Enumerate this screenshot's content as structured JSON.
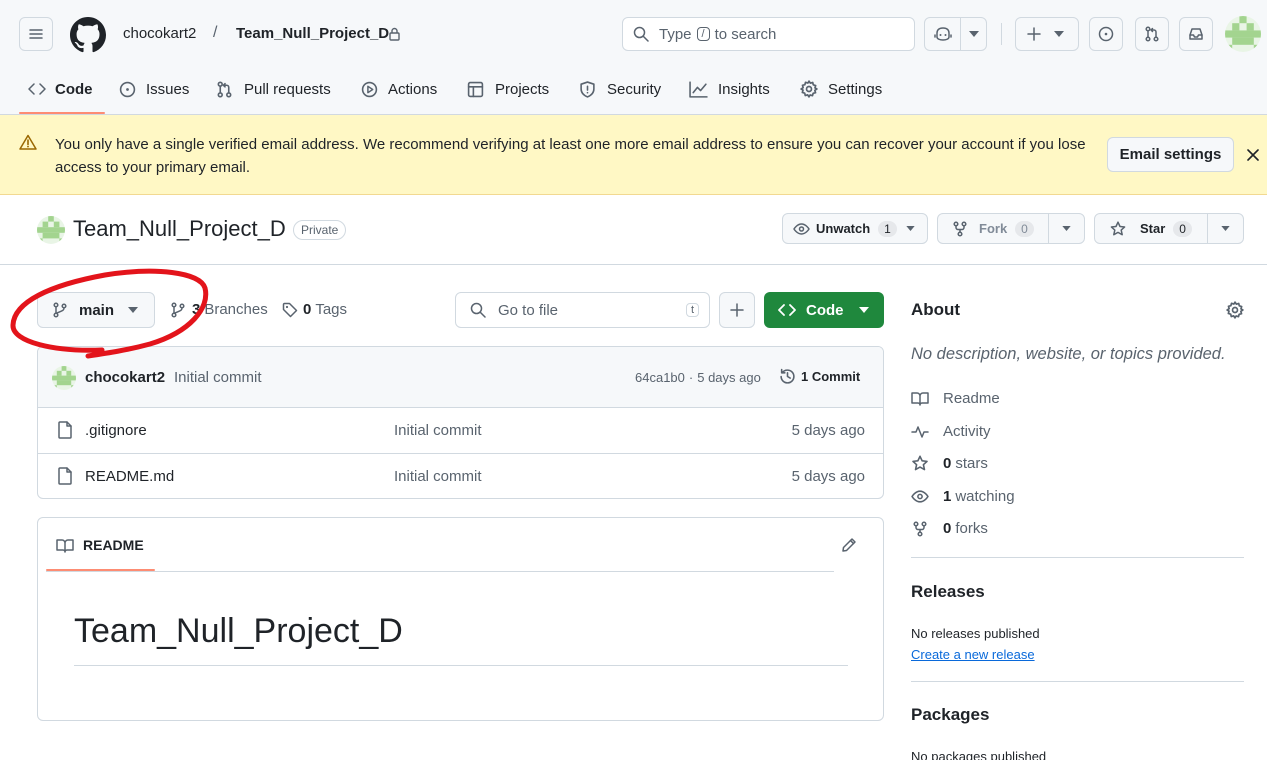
{
  "header": {
    "owner": "chocokart2",
    "separator": "/",
    "repo": "Team_Null_Project_D",
    "search_prefix": "Type",
    "search_key": "/",
    "search_suffix": "to search"
  },
  "nav": {
    "tabs": [
      {
        "label": "Code",
        "icon": "code-icon",
        "active": true
      },
      {
        "label": "Issues",
        "icon": "issue-icon"
      },
      {
        "label": "Pull requests",
        "icon": "pull-request-icon"
      },
      {
        "label": "Actions",
        "icon": "play-icon"
      },
      {
        "label": "Projects",
        "icon": "table-icon"
      },
      {
        "label": "Security",
        "icon": "shield-icon"
      },
      {
        "label": "Insights",
        "icon": "graph-icon"
      },
      {
        "label": "Settings",
        "icon": "gear-icon"
      }
    ]
  },
  "banner": {
    "message": "You only have a single verified email address. We recommend verifying at least one more email address to ensure you can recover your account if you lose access to your primary email.",
    "button": "Email settings",
    "bg_color": "#fff8c5",
    "border_color": "#f2d991"
  },
  "repo_header": {
    "name": "Team_Null_Project_D",
    "visibility": "Private",
    "watch_label": "Unwatch",
    "watch_count": "1",
    "fork_label": "Fork",
    "fork_count": "0",
    "star_label": "Star",
    "star_count": "0"
  },
  "toolbar": {
    "branch": "main",
    "branches_count": "3",
    "branches_label": "Branches",
    "tags_count": "0",
    "tags_label": "Tags",
    "goto_placeholder": "Go to file",
    "goto_key": "t",
    "code_button": "Code",
    "accent": "#1f883d"
  },
  "commit": {
    "author": "chocokart2",
    "message": "Initial commit",
    "hash": "64ca1b0",
    "dot": "·",
    "time": "5 days ago",
    "count_label": "1 Commit"
  },
  "files": [
    {
      "name": ".gitignore",
      "message": "Initial commit",
      "time": "5 days ago"
    },
    {
      "name": "README.md",
      "message": "Initial commit",
      "time": "5 days ago"
    }
  ],
  "readme": {
    "tab_label": "README",
    "heading": "Team_Null_Project_D"
  },
  "about": {
    "title": "About",
    "description": "No description, website, or topics provided.",
    "readme": "Readme",
    "activity": "Activity",
    "stars_count": "0",
    "stars_label": "stars",
    "watching_count": "1",
    "watching_label": "watching",
    "forks_count": "0",
    "forks_label": "forks"
  },
  "releases": {
    "title": "Releases",
    "empty": "No releases published",
    "link": "Create a new release"
  },
  "packages": {
    "title": "Packages",
    "empty": "No packages published"
  },
  "annotation": {
    "color": "#e3141b"
  }
}
